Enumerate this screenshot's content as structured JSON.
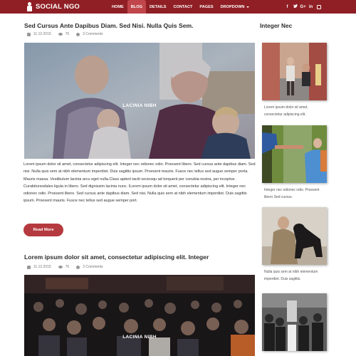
{
  "brand": {
    "name": "SOCIAL NGO",
    "icon": "person-icon"
  },
  "nav": {
    "items": [
      {
        "label": "HOME",
        "active": false
      },
      {
        "label": "BLOG",
        "active": true
      },
      {
        "label": "DETAILS",
        "active": false
      },
      {
        "label": "CONTACT",
        "active": false
      },
      {
        "label": "PAGES",
        "active": false
      },
      {
        "label": "DROPDOWN",
        "active": false
      }
    ],
    "socials": [
      "f",
      "t",
      "G+",
      "in"
    ]
  },
  "colors": {
    "nav_bg": "#8f1f25",
    "nav_active": "#c0464b",
    "button": "#b53a3f"
  },
  "posts": [
    {
      "title": "Sed Cursus Ante Dapibus Diam. Sed Nisi. Nulla Quis Sem.",
      "date": "11.12.2015",
      "views": "76",
      "comments": "3 Comments",
      "image_label": "LACINIA NIBH",
      "body": "Lorem ipsum dolor sit amet, consectetur adipiscing elit. Integer nec odionec odio. Proesent libero. Sed cursus ante dapibus diam. Sed nisi. Nulla quis sem at nibh elementum imperdiet. Duis sagittis ipsum. Proesent mauris. Fusce nec tellus sed augue semper porta. Mauris massa. Vestibulum lacinia arcu eget nulla.Class aptent taciti sociosqu ad torquent per conubia nostra, per inceptos . Curabitursodales ligula in libero. Sed dignissim lacinia nunc. ILorem ipsum dolor sit amet, consectetur adipiscing elit. Integer nec odionec odio. Proesent libero. Sed cursus ante dapibus diam. Sed nisi. Nulla quis sem at nibh elementum imperdiet. Duis sagittis ipsum. Proesent mauris. Fusce nec tellus sed augue semper port.",
      "read_more": "Read More"
    },
    {
      "title": "Lorem ipsum dolor sit amet, consectetur adipiscing elit. Integer",
      "date": "11.12.2015",
      "views": "76",
      "comments": "3 Comments",
      "image_label": "LACINIA NIBH"
    }
  ],
  "sidebar": {
    "title": "Integer Nec",
    "items": [
      {
        "caption": "Lorem ipsum dolor sit amet, consectetur adipiscing elit."
      },
      {
        "caption": "Integer nec odionec odio. Proesent libero Sed cursus."
      },
      {
        "caption": "Nulla quis sem at nibh elementum imperdiet. Duis sagittis."
      }
    ]
  }
}
